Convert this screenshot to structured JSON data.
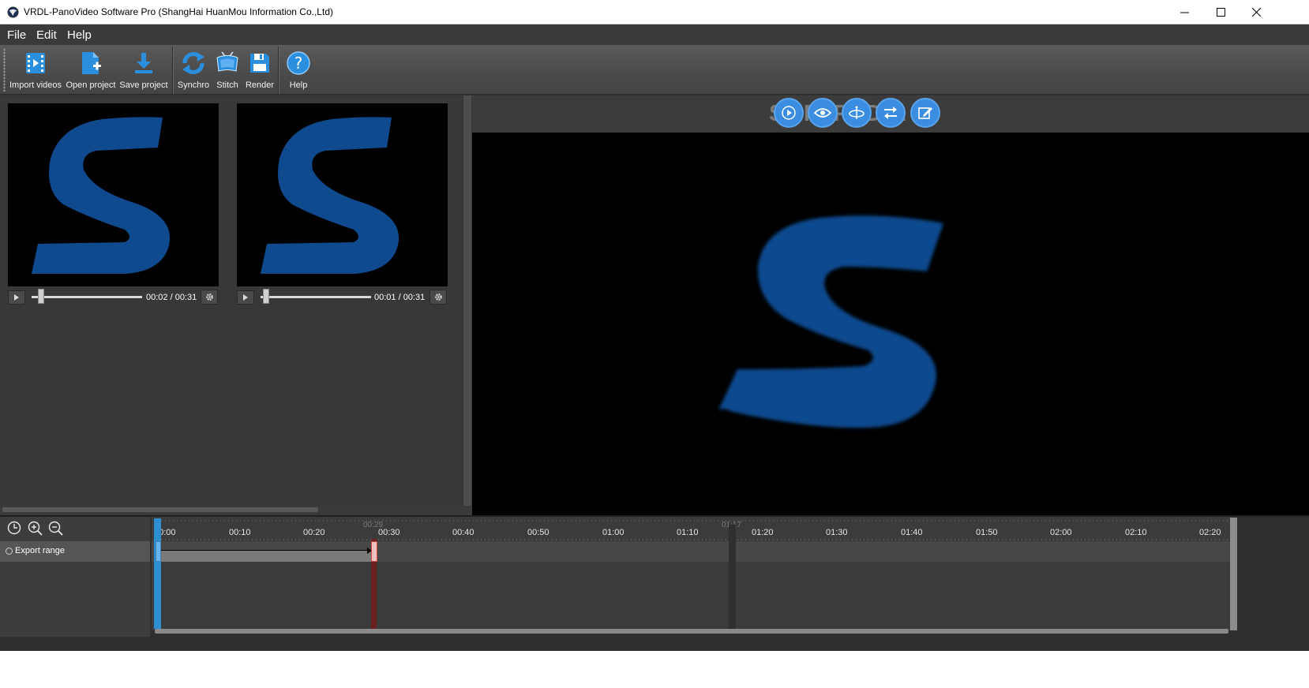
{
  "window": {
    "title": "VRDL-PanoVideo Software Pro (ShangHai HuanMou Information Co.,Ltd)",
    "icon": "app-globe-icon"
  },
  "menu": {
    "file": "File",
    "edit": "Edit",
    "help": "Help"
  },
  "toolbar": {
    "import_videos": "Import videos",
    "open_project": "Open project",
    "save_project": "Save project",
    "synchro": "Synchro",
    "stitch": "Stitch",
    "render": "Render",
    "help": "Help"
  },
  "videos": [
    {
      "time": "00:02 / 00:31",
      "progress": 0.065
    },
    {
      "time": "00:01 / 00:31",
      "progress": 0.032
    }
  ],
  "preview": {
    "watermark": "SOFTPEDIA",
    "buttons": [
      "play-icon",
      "eye-icon",
      "gyroscope-icon",
      "swap-icon",
      "edit-icon"
    ]
  },
  "timeline": {
    "track_label": "Export range",
    "ruler_labels": [
      "00:00",
      "00:10",
      "00:20",
      "00:30",
      "00:40",
      "00:50",
      "01:00",
      "01:10",
      "01:20",
      "01:30",
      "01:40",
      "01:50",
      "02:00",
      "02:10",
      "02:20"
    ],
    "cursor_marker": "00:29",
    "end_marker": "01:17"
  },
  "colors": {
    "accent_blue": "#2d8fd0",
    "logo_blue": "#0f4a8e",
    "range_end_red": "#c44444"
  }
}
